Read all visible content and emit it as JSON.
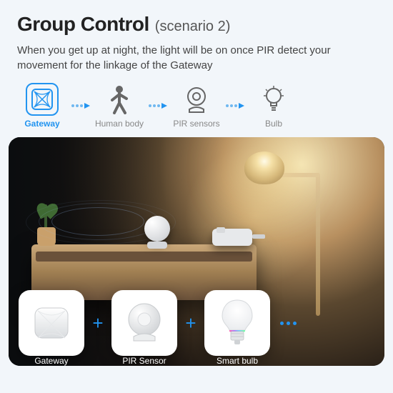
{
  "header": {
    "title": "Group Control",
    "subtitle": "(scenario 2)"
  },
  "description": "When you get up at night, the light will be on once PIR detect your movement for the linkage of the Gateway",
  "flow": {
    "items": [
      {
        "label": "Gateway",
        "icon": "gateway-icon",
        "active": true
      },
      {
        "label": "Human body",
        "icon": "human-icon",
        "active": false
      },
      {
        "label": "PIR sensors",
        "icon": "pir-icon",
        "active": false
      },
      {
        "label": "Bulb",
        "icon": "bulb-icon",
        "active": false
      }
    ]
  },
  "tiles": [
    {
      "label": "Gateway",
      "icon": "gateway-tile-icon"
    },
    {
      "label": "PIR Sensor",
      "icon": "pir-tile-icon"
    },
    {
      "label": "Smart bulb",
      "icon": "bulb-tile-icon"
    }
  ],
  "colors": {
    "accent": "#2294f0"
  }
}
